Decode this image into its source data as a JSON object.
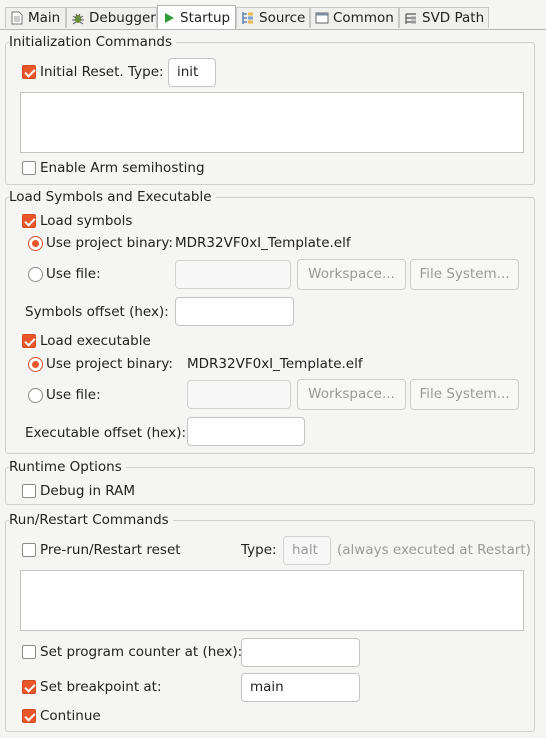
{
  "tabs": [
    {
      "label": "Main",
      "icon": "main-page-icon"
    },
    {
      "label": "Debugger",
      "icon": "debugger-bug-icon"
    },
    {
      "label": "Startup",
      "icon": "startup-play-icon"
    },
    {
      "label": "Source",
      "icon": "source-icon"
    },
    {
      "label": "Common",
      "icon": "common-window-icon"
    },
    {
      "label": "SVD Path",
      "icon": "svd-path-icon"
    }
  ],
  "active_tab": "Startup",
  "colors": {
    "accent": "#e9562a",
    "startup_icon": "#2e9a3a"
  },
  "init": {
    "group_title": "Initialization Commands",
    "initial_reset_label": "Initial Reset.",
    "initial_reset_checked": true,
    "type_label": "Type:",
    "type_value": "init",
    "commands": "",
    "semihosting_label": "Enable Arm semihosting",
    "semihosting_checked": false
  },
  "load": {
    "group_title": "Load Symbols and Executable",
    "load_symbols_label": "Load symbols",
    "load_symbols_checked": true,
    "sym_project_binary_label": "Use project binary:",
    "sym_project_binary_value": "MDR32VF0xI_Template.elf",
    "sym_use_file_label": "Use file:",
    "sym_file_value": "",
    "workspace_button": "Workspace...",
    "filesystem_button": "File System...",
    "symbols_offset_label": "Symbols offset (hex):",
    "symbols_offset_value": "",
    "load_executable_label": "Load executable",
    "load_executable_checked": true,
    "exe_project_binary_label": "Use project binary:",
    "exe_project_binary_value": "MDR32VF0xI_Template.elf",
    "exe_use_file_label": "Use file:",
    "exe_file_value": "",
    "executable_offset_label": "Executable offset (hex):",
    "executable_offset_value": ""
  },
  "runtime": {
    "group_title": "Runtime Options",
    "debug_in_ram_label": "Debug in RAM",
    "debug_in_ram_checked": false
  },
  "run": {
    "group_title": "Run/Restart Commands",
    "pre_run_label": "Pre-run/Restart reset",
    "pre_run_checked": false,
    "type_label": "Type:",
    "type_value": "halt",
    "type_note": "(always executed at Restart)",
    "commands": "",
    "set_pc_label": "Set program counter at (hex):",
    "set_pc_checked": false,
    "set_pc_value": "",
    "set_bp_label": "Set breakpoint at:",
    "set_bp_checked": true,
    "set_bp_value": "main",
    "continue_label": "Continue",
    "continue_checked": true
  }
}
